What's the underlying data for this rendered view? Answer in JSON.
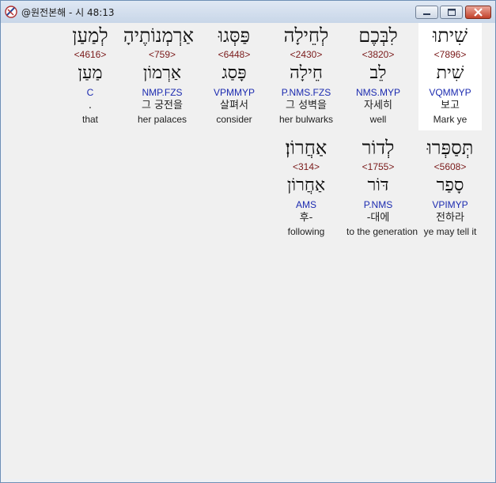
{
  "window": {
    "title": "@원전본해 - 시 48:13"
  },
  "rows": [
    [
      {
        "hebrew": "שִׁיתוּ",
        "strong": "<7896>",
        "lemma": "שִׁית",
        "morph": "VQMMYP",
        "korean": "보고",
        "english": "Mark ye",
        "highlight": true
      },
      {
        "hebrew": "לִבְּכֶם",
        "strong": "<3820>",
        "lemma": "לֵב",
        "morph": "NMS.MYP",
        "korean": "자세히",
        "english": "well",
        "highlight": false
      },
      {
        "hebrew": "לְחֵילָה",
        "strong": "<2430>",
        "lemma": "חֵילָה",
        "morph": "P.NMS.FZS",
        "korean": "그 성벽을",
        "english": "her bulwarks",
        "highlight": false
      },
      {
        "hebrew": "פַּסְּגוּ",
        "strong": "<6448>",
        "lemma": "פָּסַג",
        "morph": "VPMMYP",
        "korean": "살펴서",
        "english": "consider",
        "highlight": false
      },
      {
        "hebrew": "אַרְמְנוֹתֶיהָ",
        "strong": "<759>",
        "lemma": "אַרְמוֹן",
        "morph": "NMP.FZS",
        "korean": "그 궁전을",
        "english": "her palaces",
        "highlight": false
      },
      {
        "hebrew": "לְמַעַן",
        "strong": "<4616>",
        "lemma": "מַעַן",
        "morph": "C",
        "korean": ".",
        "english": "that",
        "highlight": false
      }
    ],
    [
      {
        "hebrew": "תְּסַפְּרוּ",
        "strong": "<5608>",
        "lemma": "סָפַר",
        "morph": "VPIMYP",
        "korean": "전하라",
        "english": "ye may tell it",
        "highlight": false
      },
      {
        "hebrew": "לְדוֹר",
        "strong": "<1755>",
        "lemma": "דּוֹר",
        "morph": "P.NMS",
        "korean": "-대에",
        "english": "to the generation",
        "highlight": false
      },
      {
        "hebrew": "אַחֲרוֹן׃",
        "strong": "<314>",
        "lemma": "אַחֲרוֹן",
        "morph": "AMS",
        "korean": "후-",
        "english": "following",
        "highlight": false
      }
    ]
  ],
  "colors": {
    "strong": "#7a1a1a",
    "morph": "#1c2bb0",
    "highlight_bg": "#ffffff",
    "client_bg": "#f0f0f0"
  }
}
